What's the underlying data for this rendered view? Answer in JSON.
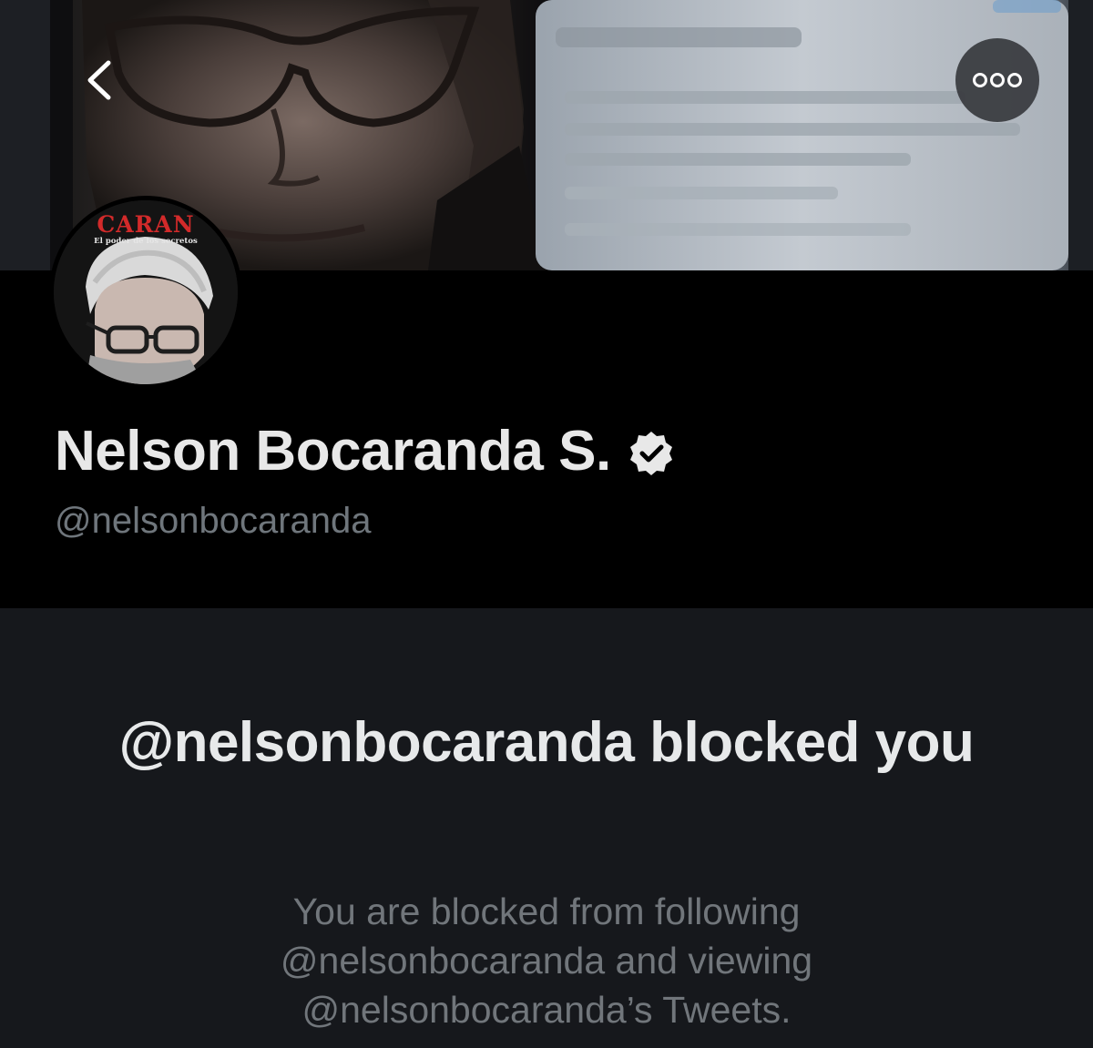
{
  "banner": {
    "back_icon": "chevron-left-icon",
    "more_icon": "more-horizontal-icon"
  },
  "avatar": {
    "book_title": "CARAN",
    "book_subtitle": "El poder de los secretos"
  },
  "profile": {
    "display_name": "Nelson Bocaranda S.",
    "verified_icon": "verified-badge-icon",
    "handle": "@nelsonbocaranda"
  },
  "blocked": {
    "title": "@nelsonbocaranda blocked you",
    "description": "You are blocked from following @nelsonbocaranda and viewing @nelsonbocaranda’s Tweets."
  },
  "colors": {
    "background": "#000000",
    "panel": "#16181c",
    "primary_text": "#e7e9ea",
    "secondary_text": "#71767b",
    "button_bg": "#37393e"
  }
}
